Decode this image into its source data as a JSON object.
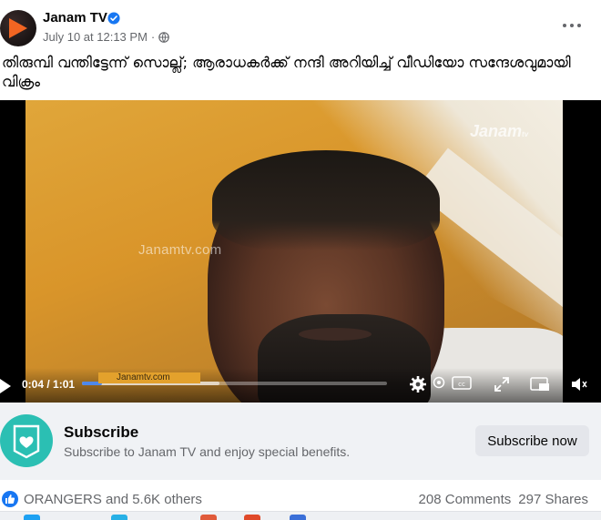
{
  "post": {
    "page_name": "Janam TV",
    "date": "July 10 at 12:13 PM",
    "separator": "·",
    "caption": "തിരുമ്പി വന്തിട്ടേന്ന് സൊല്ല്; ആരാധകർക്ക് നന്ദി അറിയിച്ച് വീഡിയോ സന്ദേശവുമായി വിക്രം",
    "icons": {
      "verified": "verified-badge-icon",
      "audience": "globe-icon",
      "menu": "more-options-icon"
    }
  },
  "video": {
    "watermark": "Janamtv.com",
    "logo": "Janam",
    "logo_suffix": "tv",
    "ticker_text": "Janamtv.com",
    "current_time": "0:04",
    "duration": "1:01",
    "time_separator": " / ",
    "progress_fraction": 0.065,
    "buffered_fraction": 0.45,
    "colors": {
      "progress": "#4e88ea",
      "ticker": "#e3a12c"
    },
    "icons": [
      "play-icon",
      "settings-icon",
      "hd-icon",
      "captions-icon",
      "fullscreen-icon",
      "picture-in-picture-icon",
      "volume-icon"
    ]
  },
  "subscribe": {
    "title": "Subscribe",
    "description": "Subscribe to Janam TV and enjoy special benefits.",
    "button": "Subscribe now",
    "colors": {
      "badge": "#2bbfb3",
      "background": "#f0f2f5"
    }
  },
  "reactions": {
    "reactors": "ORANGERS and 5.6K others",
    "comments": "208 Comments",
    "shares": "297 Shares",
    "colors": {
      "like": "#1877f2"
    }
  }
}
